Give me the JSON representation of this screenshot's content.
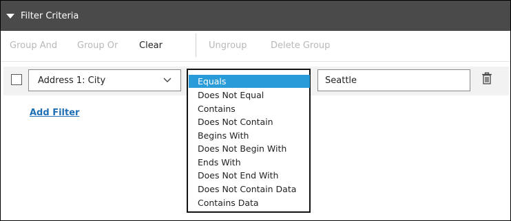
{
  "header": {
    "title": "Filter Criteria"
  },
  "toolbar": {
    "group_and": "Group And",
    "group_or": "Group Or",
    "clear": "Clear",
    "ungroup": "Ungroup",
    "delete_group": "Delete Group"
  },
  "row": {
    "field": "Address 1: City",
    "value": "Seattle"
  },
  "add_filter": "Add Filter",
  "operator_options": [
    "Equals",
    "Does Not Equal",
    "Contains",
    "Does Not Contain",
    "Begins With",
    "Does Not Begin With",
    "Ends With",
    "Does Not End With",
    "Does Not Contain Data",
    "Contains Data"
  ],
  "selected_operator": "Equals",
  "colors": {
    "header_bg": "#4a4a4a",
    "selected_bg": "#2a9bd9",
    "link": "#1f6fb5",
    "disabled_text": "#b8b8b8"
  },
  "icons": {
    "collapse": "triangle-down-icon",
    "dropdown": "chevron-down-icon",
    "delete": "trash-icon"
  }
}
